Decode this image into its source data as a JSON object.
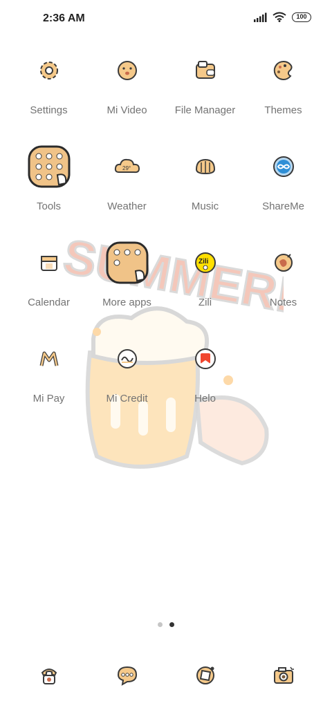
{
  "status_bar": {
    "time": "2:36 AM",
    "battery": "100"
  },
  "apps": [
    {
      "label": "Settings",
      "icon": "gear-icon"
    },
    {
      "label": "Mi Video",
      "icon": "face-icon"
    },
    {
      "label": "File Manager",
      "icon": "folder-icon"
    },
    {
      "label": "Themes",
      "icon": "palette-icon"
    },
    {
      "label": "Tools",
      "icon": "folder-grid-icon"
    },
    {
      "label": "Weather",
      "icon": "cloud-icon"
    },
    {
      "label": "Music",
      "icon": "bread-icon"
    },
    {
      "label": "ShareMe",
      "icon": "shareme-icon"
    },
    {
      "label": "Calendar",
      "icon": "calendar-icon"
    },
    {
      "label": "More apps",
      "icon": "folder-grid-icon"
    },
    {
      "label": "Zili",
      "icon": "zili-icon"
    },
    {
      "label": "Notes",
      "icon": "notes-icon"
    },
    {
      "label": "Mi Pay",
      "icon": "mipay-icon"
    },
    {
      "label": "Mi Credit",
      "icon": "micredit-icon"
    },
    {
      "label": "Helo",
      "icon": "helo-icon"
    }
  ],
  "weather_temp": "29°",
  "zili_badge": "Zili",
  "wallpaper_text": "SUMMER!",
  "page_indicator": {
    "pages": 2,
    "active": 2
  },
  "dock": [
    {
      "icon": "phone-icon"
    },
    {
      "icon": "messages-icon"
    },
    {
      "icon": "browser-icon"
    },
    {
      "icon": "camera-icon"
    }
  ],
  "colors": {
    "accent": "#f5c98a",
    "outline": "#3a3a3a",
    "label": "#737373"
  }
}
